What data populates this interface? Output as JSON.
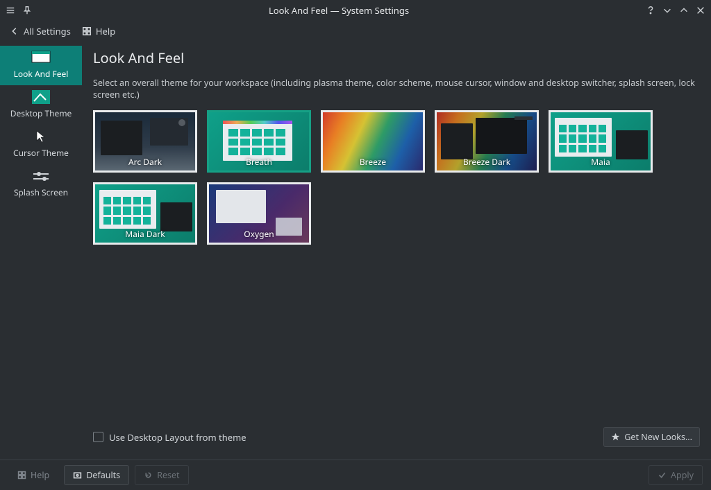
{
  "window": {
    "title": "Look And Feel — System Settings"
  },
  "toolbar": {
    "all_settings": "All Settings",
    "help": "Help"
  },
  "sidebar": {
    "items": [
      {
        "label": "Look And Feel"
      },
      {
        "label": "Desktop Theme"
      },
      {
        "label": "Cursor Theme"
      },
      {
        "label": "Splash Screen"
      }
    ]
  },
  "page": {
    "title": "Look And Feel",
    "description": "Select an overall theme for your workspace (including plasma theme, color scheme, mouse cursor, window and desktop switcher, splash screen, lock screen etc.)",
    "checkbox_label": "Use Desktop Layout from theme",
    "get_new_label": "Get New Looks..."
  },
  "themes": [
    {
      "name": "Arc Dark",
      "selected": false
    },
    {
      "name": "Breath",
      "selected": true
    },
    {
      "name": "Breeze",
      "selected": false
    },
    {
      "name": "Breeze Dark",
      "selected": false
    },
    {
      "name": "Maia",
      "selected": false
    },
    {
      "name": "Maia Dark",
      "selected": false
    },
    {
      "name": "Oxygen",
      "selected": false
    }
  ],
  "buttons": {
    "help": "Help",
    "defaults": "Defaults",
    "reset": "Reset",
    "apply": "Apply"
  }
}
